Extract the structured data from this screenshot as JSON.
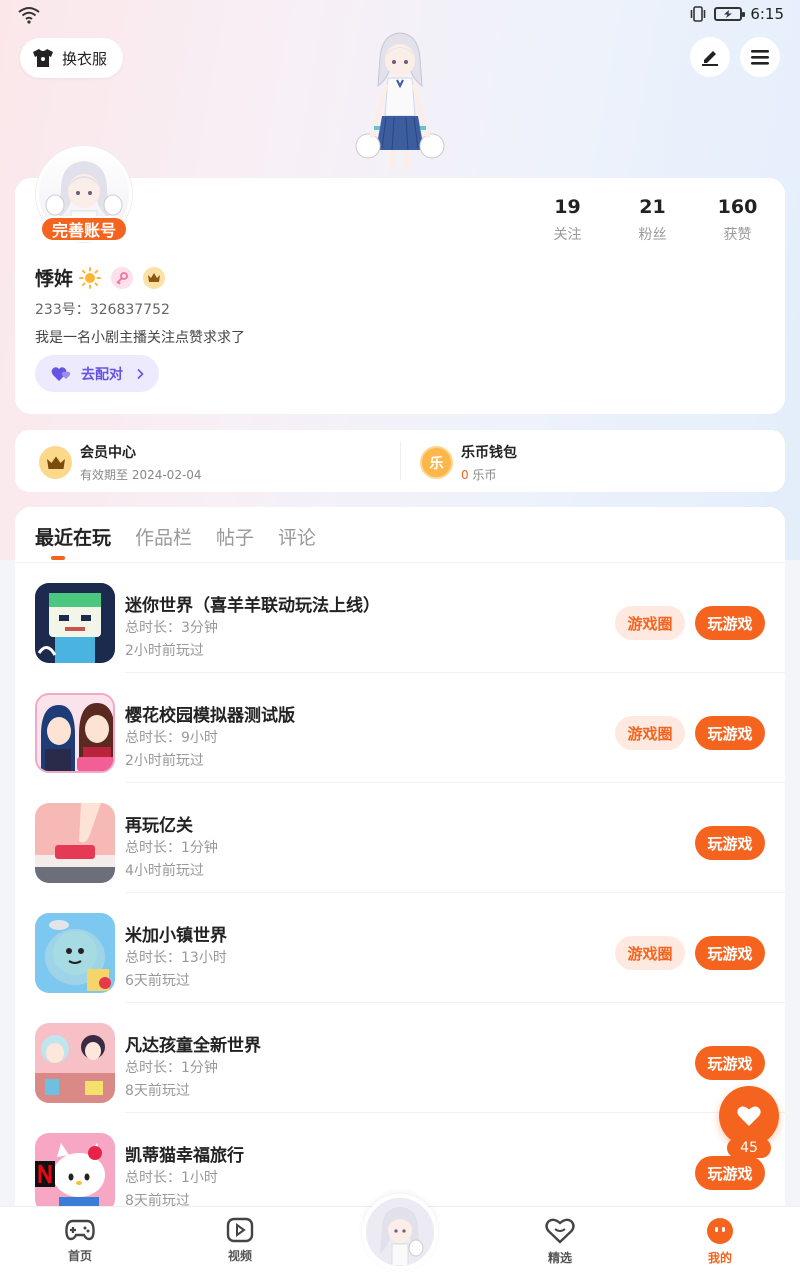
{
  "status_bar": {
    "time": "6:15"
  },
  "header": {
    "outfit_label": "换衣服",
    "edit_icon": "pen-icon",
    "menu_icon": "hamburger-icon"
  },
  "profile": {
    "complete_label": "完善账号",
    "stats": [
      {
        "num": "19",
        "label": "关注"
      },
      {
        "num": "21",
        "label": "粉丝"
      },
      {
        "num": "160",
        "label": "获赞"
      }
    ],
    "nickname": "悸姩",
    "uid": "233号：326837752",
    "bio": "我是一名小剧主播关注点赞求求了",
    "pair_label": "去配对"
  },
  "membership": {
    "vip_title": "会员中心",
    "vip_sub": "有效期至 2024-02-04",
    "wallet_title": "乐币钱包",
    "wallet_icon_char": "乐",
    "wallet_amount": "0",
    "wallet_unit": "乐币"
  },
  "tabs": [
    "最近在玩",
    "作品栏",
    "帖子",
    "评论"
  ],
  "games": [
    {
      "name": "迷你世界（喜羊羊联动玩法上线）",
      "duration": "总时长：3分钟",
      "last": "2小时前玩过",
      "has_circle": true
    },
    {
      "name": "樱花校园模拟器测试版",
      "duration": "总时长：9小时",
      "last": "2小时前玩过",
      "has_circle": true
    },
    {
      "name": "再玩亿关",
      "duration": "总时长：1分钟",
      "last": "4小时前玩过",
      "has_circle": false
    },
    {
      "name": "米加小镇世界",
      "duration": "总时长：13小时",
      "last": "6天前玩过",
      "has_circle": true
    },
    {
      "name": "凡达孩童全新世界",
      "duration": "总时长：1分钟",
      "last": "8天前玩过",
      "has_circle": false
    },
    {
      "name": "凯蒂猫幸福旅行",
      "duration": "总时长：1小时",
      "last": "8天前玩过",
      "has_circle": false
    }
  ],
  "buttons": {
    "circle": "游戏圈",
    "play": "玩游戏"
  },
  "float_like": {
    "count": "45"
  },
  "nav": {
    "items": [
      {
        "label": "首页",
        "icon": "gamepad-icon"
      },
      {
        "label": "视频",
        "icon": "play-icon"
      },
      {
        "label": "精选",
        "icon": "heart-chat-icon"
      },
      {
        "label": "我的",
        "icon": "face-icon"
      }
    ]
  },
  "colors": {
    "accent": "#f5641e",
    "pair": "#6654e3"
  }
}
